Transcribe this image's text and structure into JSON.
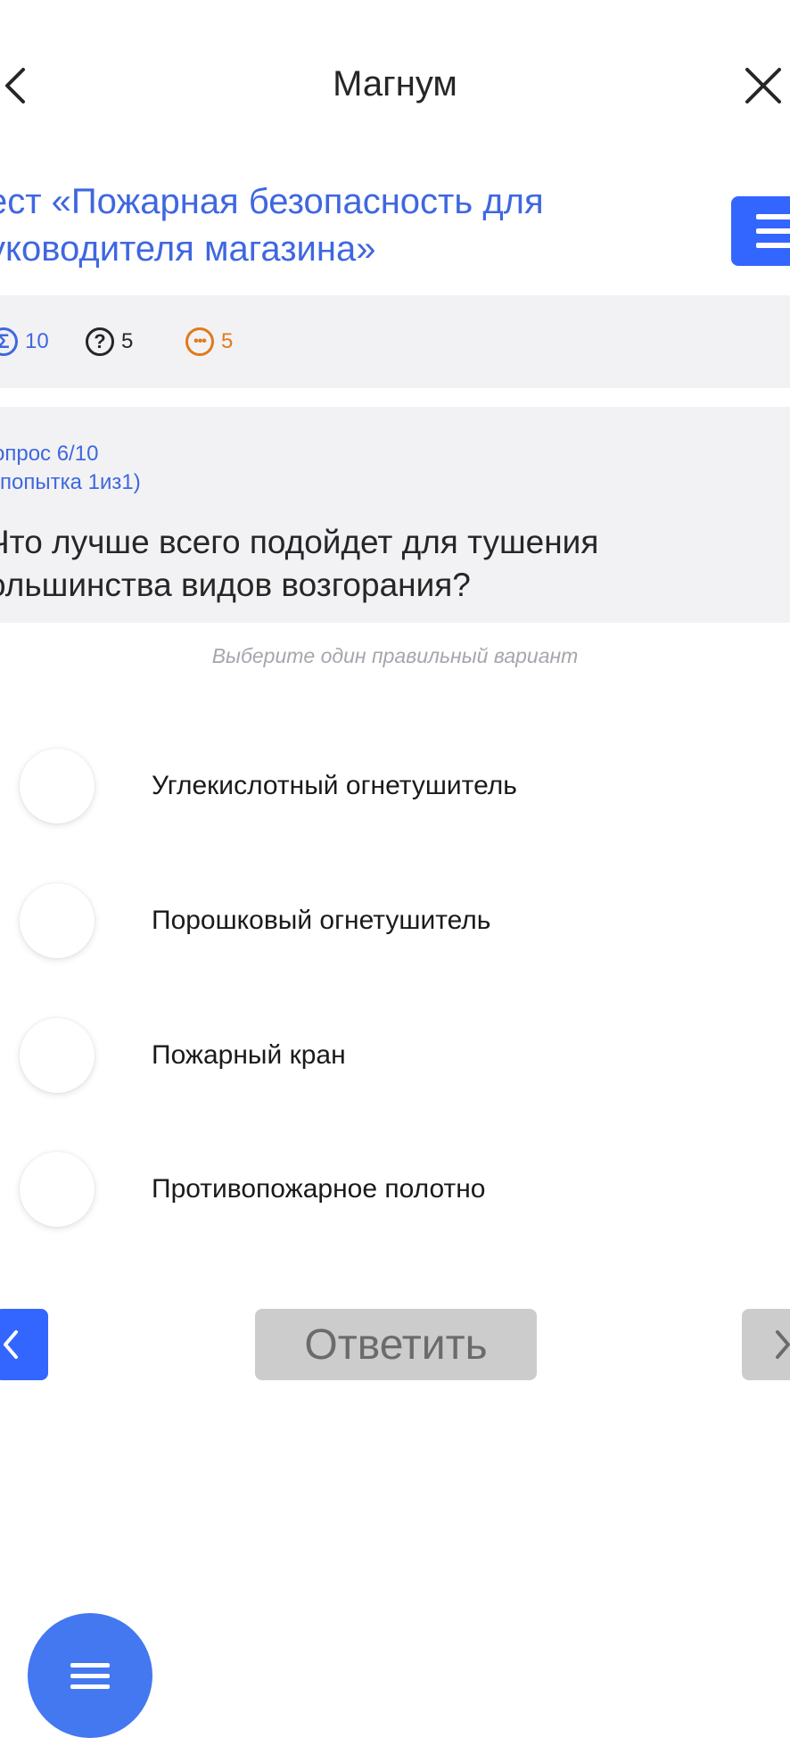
{
  "header": {
    "title": "Магнум",
    "back_icon": "chevron-left-icon",
    "close_icon": "close-icon"
  },
  "test": {
    "title_line1": "ест «Пожарная безопасность для",
    "title_line2": "уководителя магазина»",
    "menu_icon": "menu-icon"
  },
  "stats": {
    "total": "10",
    "questions": "5",
    "pending": "5"
  },
  "question": {
    "counter": "опрос 6/10",
    "attempt": "(попытка 1из1)",
    "text": "Что лучше всего подойдет для тушения большинства видов возгорания?",
    "text_line1": "Что лучше всего подойдет для тушения",
    "text_line2": "ольшинства видов возгорания?"
  },
  "hint": "Выберите один правильный вариант",
  "options": [
    {
      "label": "Углекислотный огнетушитель"
    },
    {
      "label": "Порошковый огнетушитель"
    },
    {
      "label": "Пожарный кран"
    },
    {
      "label": "Противопожарное полотно"
    }
  ],
  "nav": {
    "answer_label": "Ответить"
  },
  "colors": {
    "accent": "#3366ff",
    "link": "#3f67e0",
    "warning": "#e07a1a",
    "disabled": "#cccccc"
  }
}
